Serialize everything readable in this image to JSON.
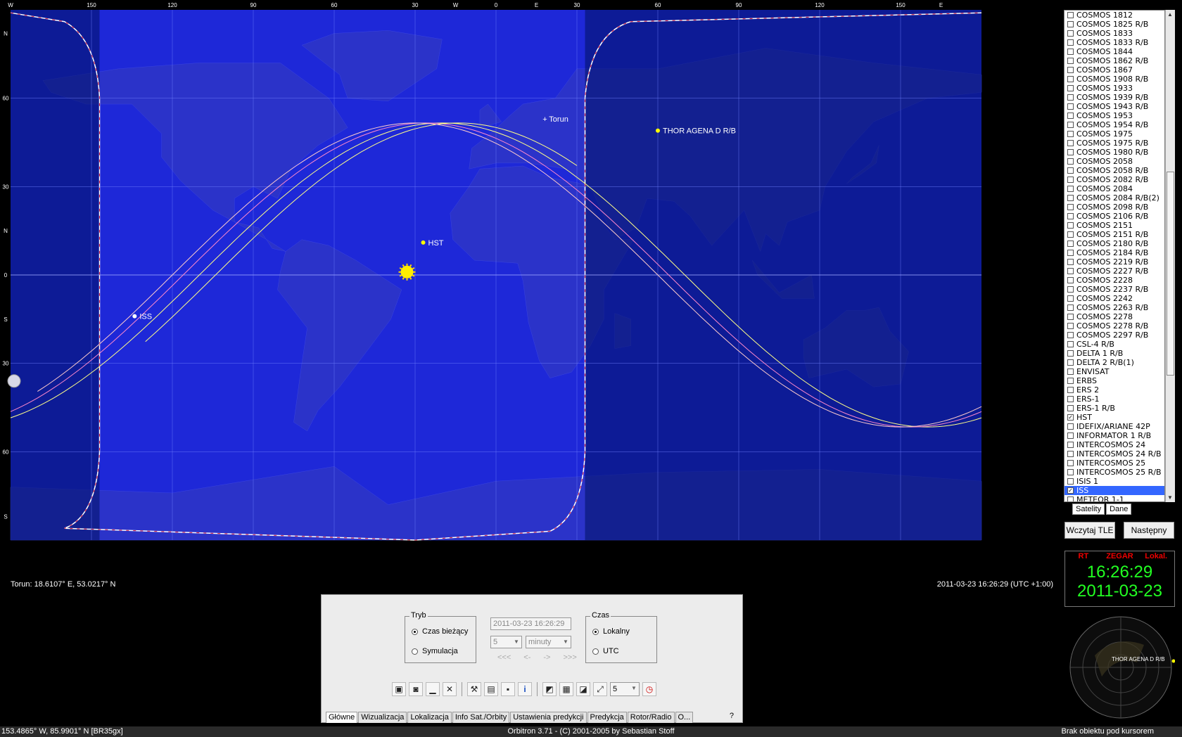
{
  "map": {
    "top_ticks": [
      {
        "label": "W",
        "lon": -180
      },
      {
        "label": "150",
        "lon": -150
      },
      {
        "label": "120",
        "lon": -120
      },
      {
        "label": "90",
        "lon": -90
      },
      {
        "label": "60",
        "lon": -60
      },
      {
        "label": "30",
        "lon": -30
      },
      {
        "label": "W",
        "lon": -15
      },
      {
        "label": "0",
        "lon": 0
      },
      {
        "label": "E",
        "lon": 15
      },
      {
        "label": "30",
        "lon": 30
      },
      {
        "label": "60",
        "lon": 60
      },
      {
        "label": "90",
        "lon": 90
      },
      {
        "label": "120",
        "lon": 120
      },
      {
        "label": "150",
        "lon": 150
      },
      {
        "label": "E",
        "lon": 165
      }
    ],
    "left_ticks": [
      {
        "label": "N",
        "lat": 82
      },
      {
        "label": "60",
        "lat": 60
      },
      {
        "label": "30",
        "lat": 30
      },
      {
        "label": "N",
        "lat": 15
      },
      {
        "label": "0",
        "lat": 0
      },
      {
        "label": "S",
        "lat": -15
      },
      {
        "label": "30",
        "lat": -30
      },
      {
        "label": "60",
        "lat": -60
      },
      {
        "label": "S",
        "lat": -82
      }
    ],
    "satellites": [
      {
        "name": "ISS",
        "lon": -134,
        "lat": -14,
        "color": "#ffffff"
      },
      {
        "name": "HST",
        "lon": -27,
        "lat": 11,
        "color": "#ffff00"
      },
      {
        "name": "THOR AGENA D R/B",
        "lon": 60,
        "lat": 49,
        "color": "#ffff00"
      }
    ],
    "observer": {
      "name": "Torun",
      "lon": 18.6,
      "lat": 53.0
    },
    "sun": {
      "lon": -33,
      "lat": 1
    },
    "left_status": "Torun: 18.6107° E, 53.0217° N",
    "right_status": "2011-03-23 16:26:29 (UTC +1:00)"
  },
  "sat_list": {
    "items": [
      {
        "name": "COSMOS 1812",
        "checked": false
      },
      {
        "name": "COSMOS 1825 R/B",
        "checked": false
      },
      {
        "name": "COSMOS 1833",
        "checked": false
      },
      {
        "name": "COSMOS 1833 R/B",
        "checked": false
      },
      {
        "name": "COSMOS 1844",
        "checked": false
      },
      {
        "name": "COSMOS 1862 R/B",
        "checked": false
      },
      {
        "name": "COSMOS 1867",
        "checked": false
      },
      {
        "name": "COSMOS 1908 R/B",
        "checked": false
      },
      {
        "name": "COSMOS 1933",
        "checked": false
      },
      {
        "name": "COSMOS 1939 R/B",
        "checked": false
      },
      {
        "name": "COSMOS 1943 R/B",
        "checked": false
      },
      {
        "name": "COSMOS 1953",
        "checked": false
      },
      {
        "name": "COSMOS 1954 R/B",
        "checked": false
      },
      {
        "name": "COSMOS 1975",
        "checked": false
      },
      {
        "name": "COSMOS 1975 R/B",
        "checked": false
      },
      {
        "name": "COSMOS 1980 R/B",
        "checked": false
      },
      {
        "name": "COSMOS 2058",
        "checked": false
      },
      {
        "name": "COSMOS 2058 R/B",
        "checked": false
      },
      {
        "name": "COSMOS 2082 R/B",
        "checked": false
      },
      {
        "name": "COSMOS 2084",
        "checked": false
      },
      {
        "name": "COSMOS 2084 R/B(2)",
        "checked": false
      },
      {
        "name": "COSMOS 2098 R/B",
        "checked": false
      },
      {
        "name": "COSMOS 2106 R/B",
        "checked": false
      },
      {
        "name": "COSMOS 2151",
        "checked": false
      },
      {
        "name": "COSMOS 2151 R/B",
        "checked": false
      },
      {
        "name": "COSMOS 2180 R/B",
        "checked": false
      },
      {
        "name": "COSMOS 2184 R/B",
        "checked": false
      },
      {
        "name": "COSMOS 2219 R/B",
        "checked": false
      },
      {
        "name": "COSMOS 2227 R/B",
        "checked": false
      },
      {
        "name": "COSMOS 2228",
        "checked": false
      },
      {
        "name": "COSMOS 2237 R/B",
        "checked": false
      },
      {
        "name": "COSMOS 2242",
        "checked": false
      },
      {
        "name": "COSMOS 2263 R/B",
        "checked": false
      },
      {
        "name": "COSMOS 2278",
        "checked": false
      },
      {
        "name": "COSMOS 2278 R/B",
        "checked": false
      },
      {
        "name": "COSMOS 2297 R/B",
        "checked": false
      },
      {
        "name": "CSL-4 R/B",
        "checked": false
      },
      {
        "name": "DELTA 1 R/B",
        "checked": false
      },
      {
        "name": "DELTA 2 R/B(1)",
        "checked": false
      },
      {
        "name": "ENVISAT",
        "checked": false
      },
      {
        "name": "ERBS",
        "checked": false
      },
      {
        "name": "ERS 2",
        "checked": false
      },
      {
        "name": "ERS-1",
        "checked": false
      },
      {
        "name": "ERS-1 R/B",
        "checked": false
      },
      {
        "name": "HST",
        "checked": true
      },
      {
        "name": "IDEFIX/ARIANE 42P",
        "checked": false
      },
      {
        "name": "INFORMATOR 1 R/B",
        "checked": false
      },
      {
        "name": "INTERCOSMOS 24",
        "checked": false
      },
      {
        "name": "INTERCOSMOS 24 R/B",
        "checked": false
      },
      {
        "name": "INTERCOSMOS 25",
        "checked": false
      },
      {
        "name": "INTERCOSMOS 25 R/B",
        "checked": false
      },
      {
        "name": "ISIS 1",
        "checked": false
      },
      {
        "name": "ISS",
        "checked": true,
        "selected": true
      },
      {
        "name": "METEOR 1-1",
        "checked": false
      }
    ],
    "tabs": [
      "Satelity",
      "Dane"
    ]
  },
  "buttons": {
    "load_tle": "Wczytaj TLE",
    "next": "Następny"
  },
  "clock": {
    "rt": "RT",
    "title": "ZEGAR",
    "mode": "Lokal.",
    "time": "16:26:29",
    "date": "2011-03-23"
  },
  "radar": {
    "label": "THOR AGENA D R/B"
  },
  "control": {
    "mode_title": "Tryb",
    "current_time": "Czas bieżący",
    "simulation": "Symulacja",
    "datetime": "2011-03-23 16:26:29",
    "step": "5",
    "unit": "minuty",
    "nav": [
      "<<<",
      "<-",
      "->",
      ">>>"
    ],
    "time_title": "Czas",
    "local": "Lokalny",
    "utc": "UTC",
    "zoom": "5",
    "tabs": [
      "Główne",
      "Wizualizacja",
      "Lokalizacja",
      "Info Sat./Orbity",
      "Ustawienia predykcji",
      "Predykcja",
      "Rotor/Radio",
      "O..."
    ],
    "help": "?"
  },
  "status": {
    "left": "153.4865° W, 85.9901° N [BR35gx]",
    "center": "Orbitron 3.71 - (C) 2001-2005 by Sebastian Stoff",
    "right": "Brak obiektu pod kursorem"
  }
}
